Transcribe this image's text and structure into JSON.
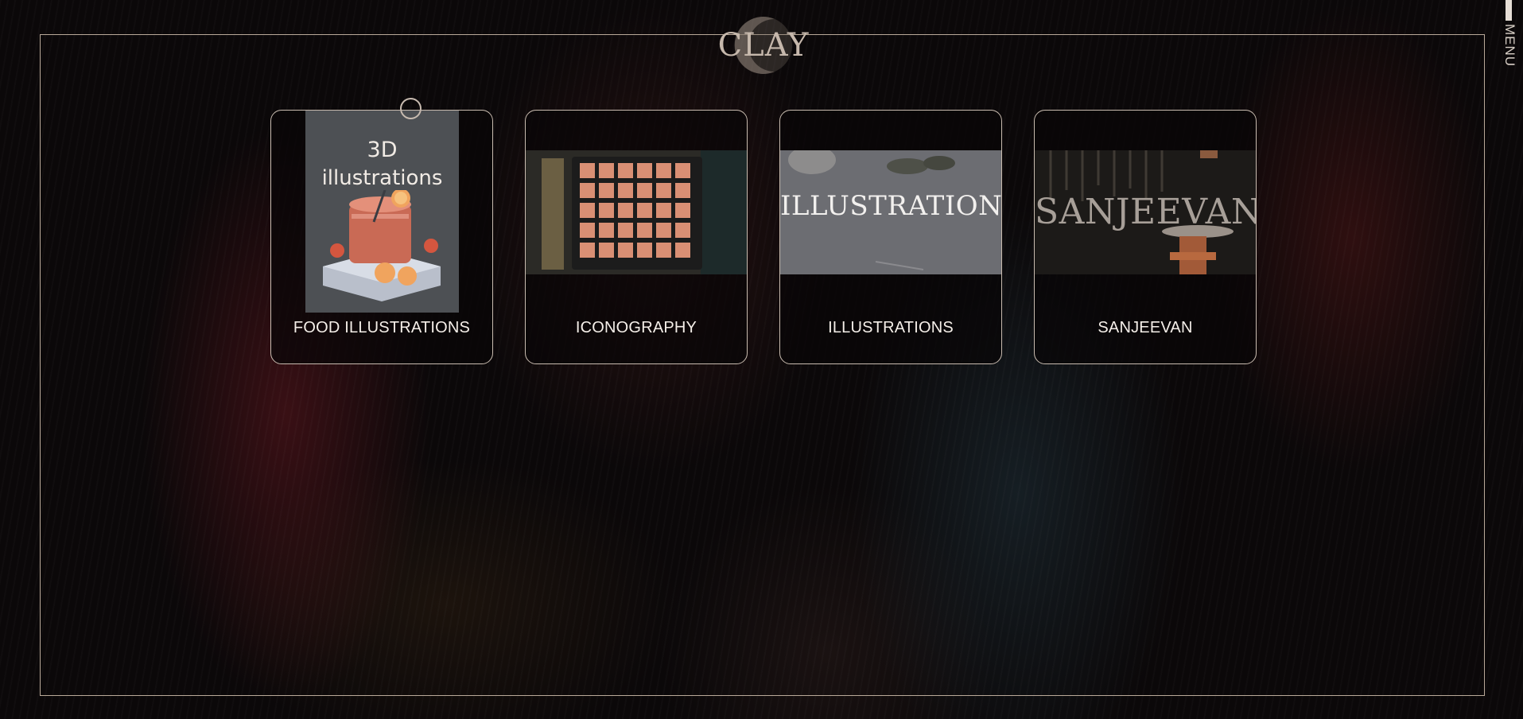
{
  "brand": {
    "logo_text": "CLAY"
  },
  "menu": {
    "label": "MENU"
  },
  "cards": [
    {
      "caption": "FOOD ILLUSTRATIONS",
      "thumb_line1": "3D",
      "thumb_line2": "illustrations"
    },
    {
      "caption": "ICONOGRAPHY"
    },
    {
      "caption": "ILLUSTRATIONS",
      "thumb_text": "ILLUSTRATIONS"
    },
    {
      "caption": "SANJEEVAN",
      "thumb_text": "SANJEEVAN"
    }
  ],
  "colors": {
    "accent": "#c9bcb0",
    "background": "#0b0809",
    "text": "#f5efe9"
  }
}
